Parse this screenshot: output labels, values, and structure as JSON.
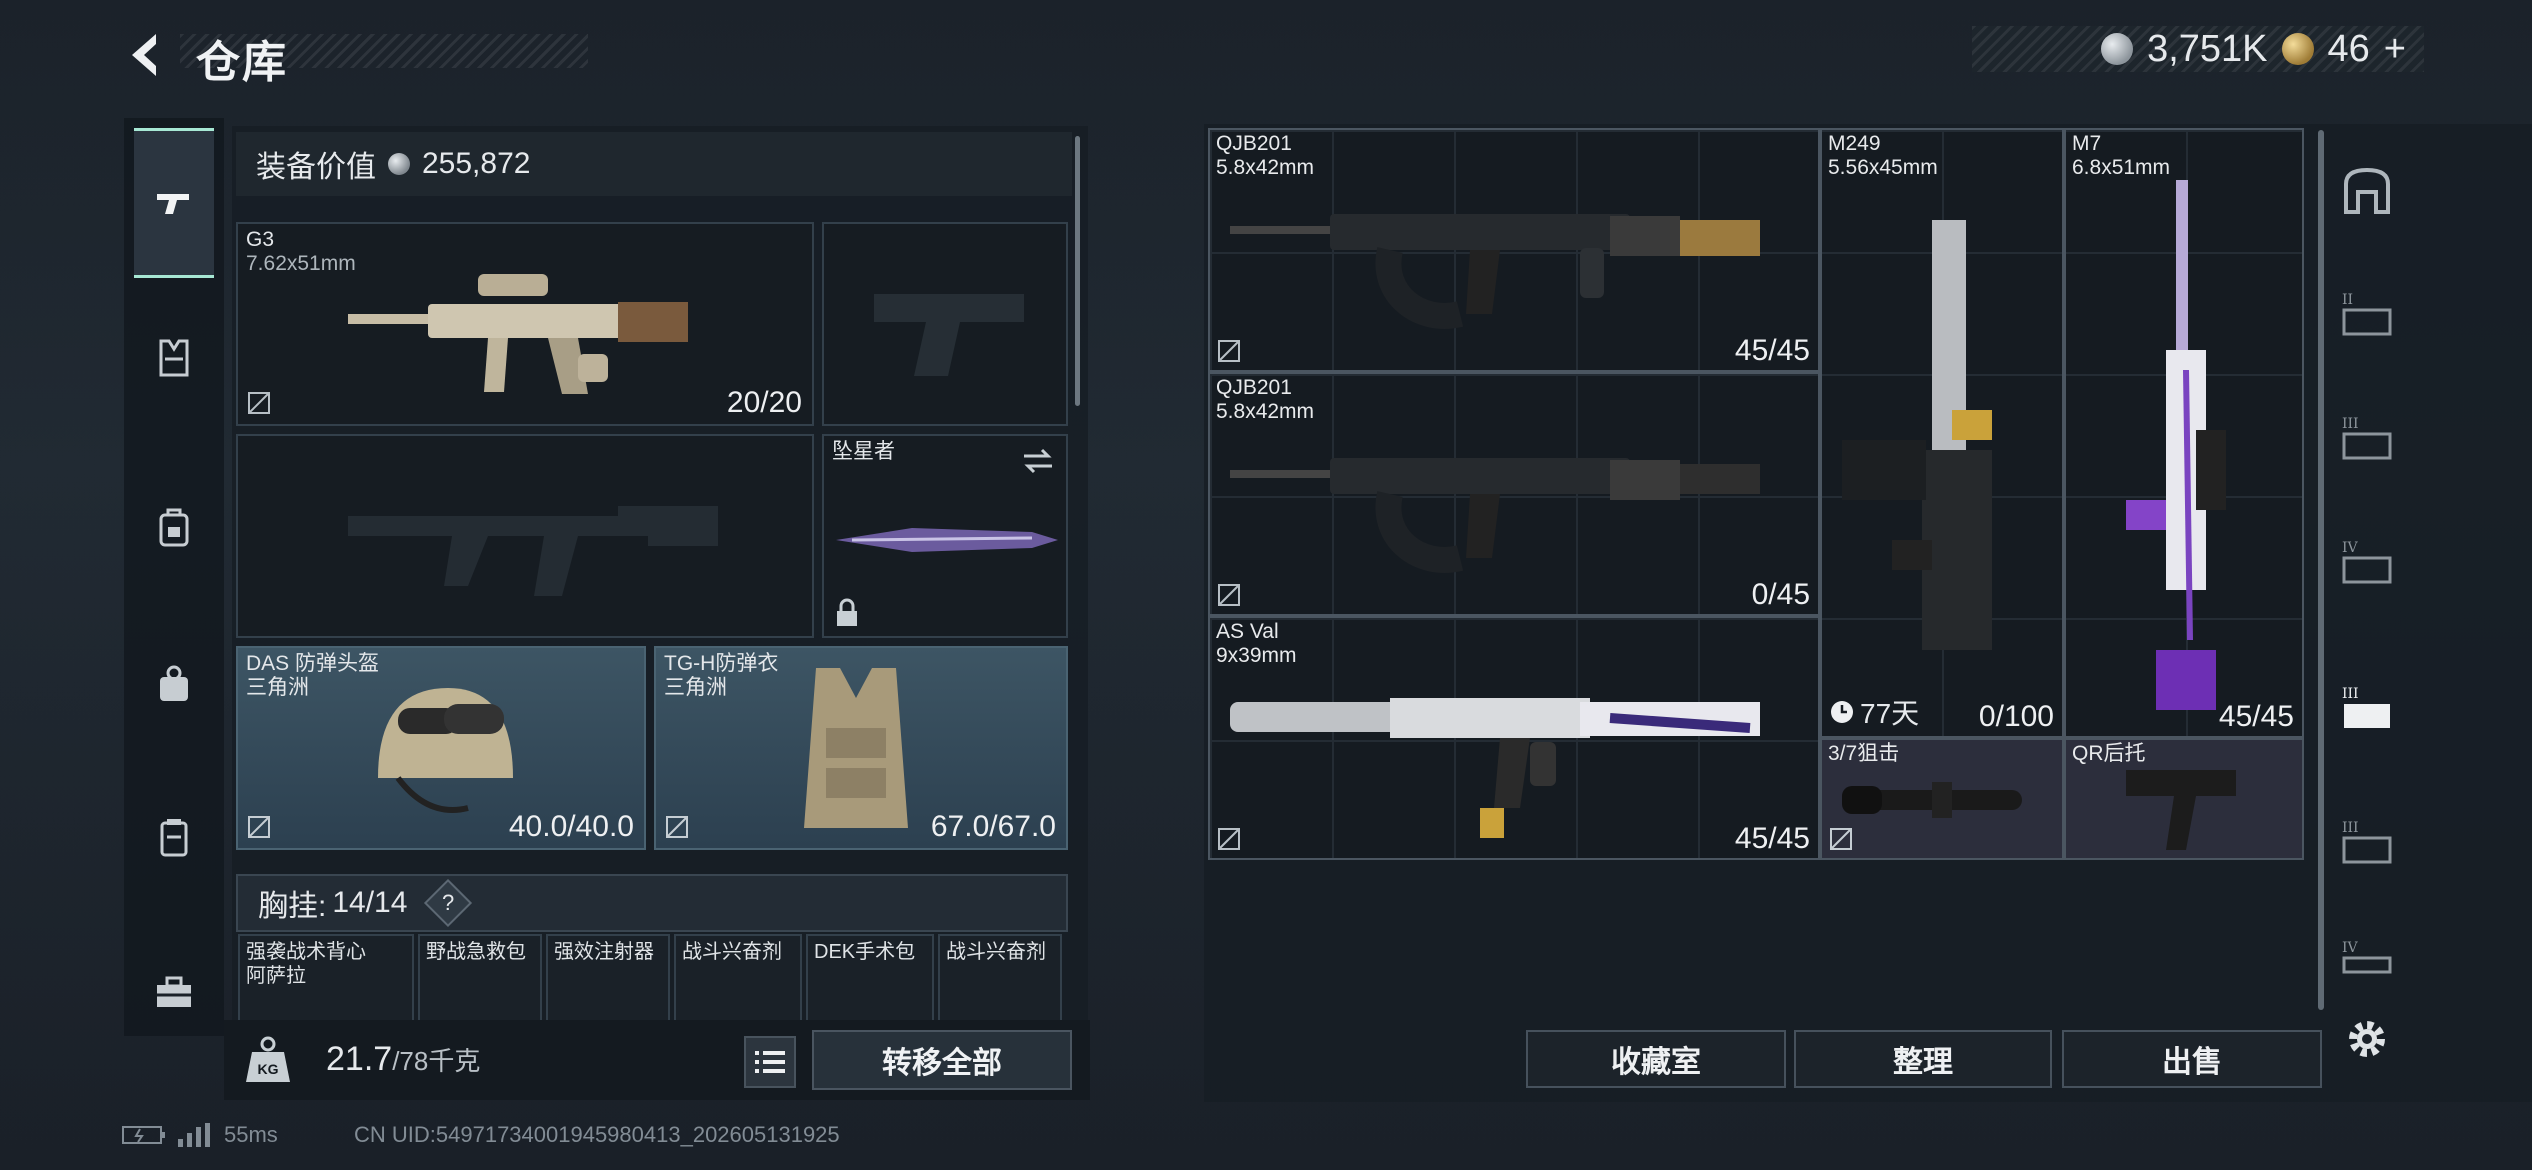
{
  "header": {
    "title": "仓库",
    "silver_amount": "3,751K",
    "gold_amount": "46",
    "gold_plus": "+"
  },
  "loadout": {
    "value_label": "装备价值",
    "value": "255,872",
    "primary": {
      "name": "G3",
      "caliber": "7.62x51mm",
      "ammo": "20/20"
    },
    "secondary_pistol_empty": true,
    "melee": {
      "name": "坠星者"
    },
    "helmet": {
      "name": "DAS 防弹头盔",
      "map": "三角洲",
      "durability": "40.0/40.0"
    },
    "armor": {
      "name": "TG-H防弹衣",
      "map": "三角洲",
      "durability": "67.0/67.0"
    },
    "rig": {
      "label": "胸挂:",
      "capacity": "14/14",
      "help": "?"
    },
    "rig_items": [
      {
        "line1": "强袭战术背心",
        "line2": "阿萨拉"
      },
      {
        "line1": "野战急救包",
        "line2": ""
      },
      {
        "line1": "强效注射器",
        "line2": ""
      },
      {
        "line1": "战斗兴奋剂",
        "line2": ""
      },
      {
        "line1": "DEK手术包",
        "line2": ""
      },
      {
        "line1": "战斗兴奋剂",
        "line2": ""
      }
    ],
    "weight": "21.7",
    "weight_max": "/78千克",
    "weight_icon_text": "KG",
    "transfer_all": "转移全部"
  },
  "storage": {
    "items": [
      {
        "name": "QJB201",
        "caliber": "5.8x42mm",
        "count": "45/45"
      },
      {
        "name": "QJB201",
        "caliber": "5.8x42mm",
        "count": "0/45"
      },
      {
        "name": "AS Val",
        "caliber": "9x39mm",
        "count": "45/45"
      },
      {
        "name": "M249",
        "caliber": "5.56x45mm",
        "count": "0/100",
        "timer": "77天"
      },
      {
        "name": "M7",
        "caliber": "6.8x51mm",
        "count": "45/45"
      },
      {
        "name": "3/7狙击",
        "caliber": ""
      },
      {
        "name": "QR后托",
        "caliber": ""
      }
    ],
    "buttons": {
      "collection": "收藏室",
      "organize": "整理",
      "sell": "出售"
    }
  },
  "status_bar": {
    "ping": "55ms",
    "uid": "CN UID:5497173400194598041​3_202605131925"
  },
  "colors": {
    "accent": "#a7e8d4",
    "armor_bg": "#3d5564",
    "attachment_bg": "#2c2e3c"
  }
}
